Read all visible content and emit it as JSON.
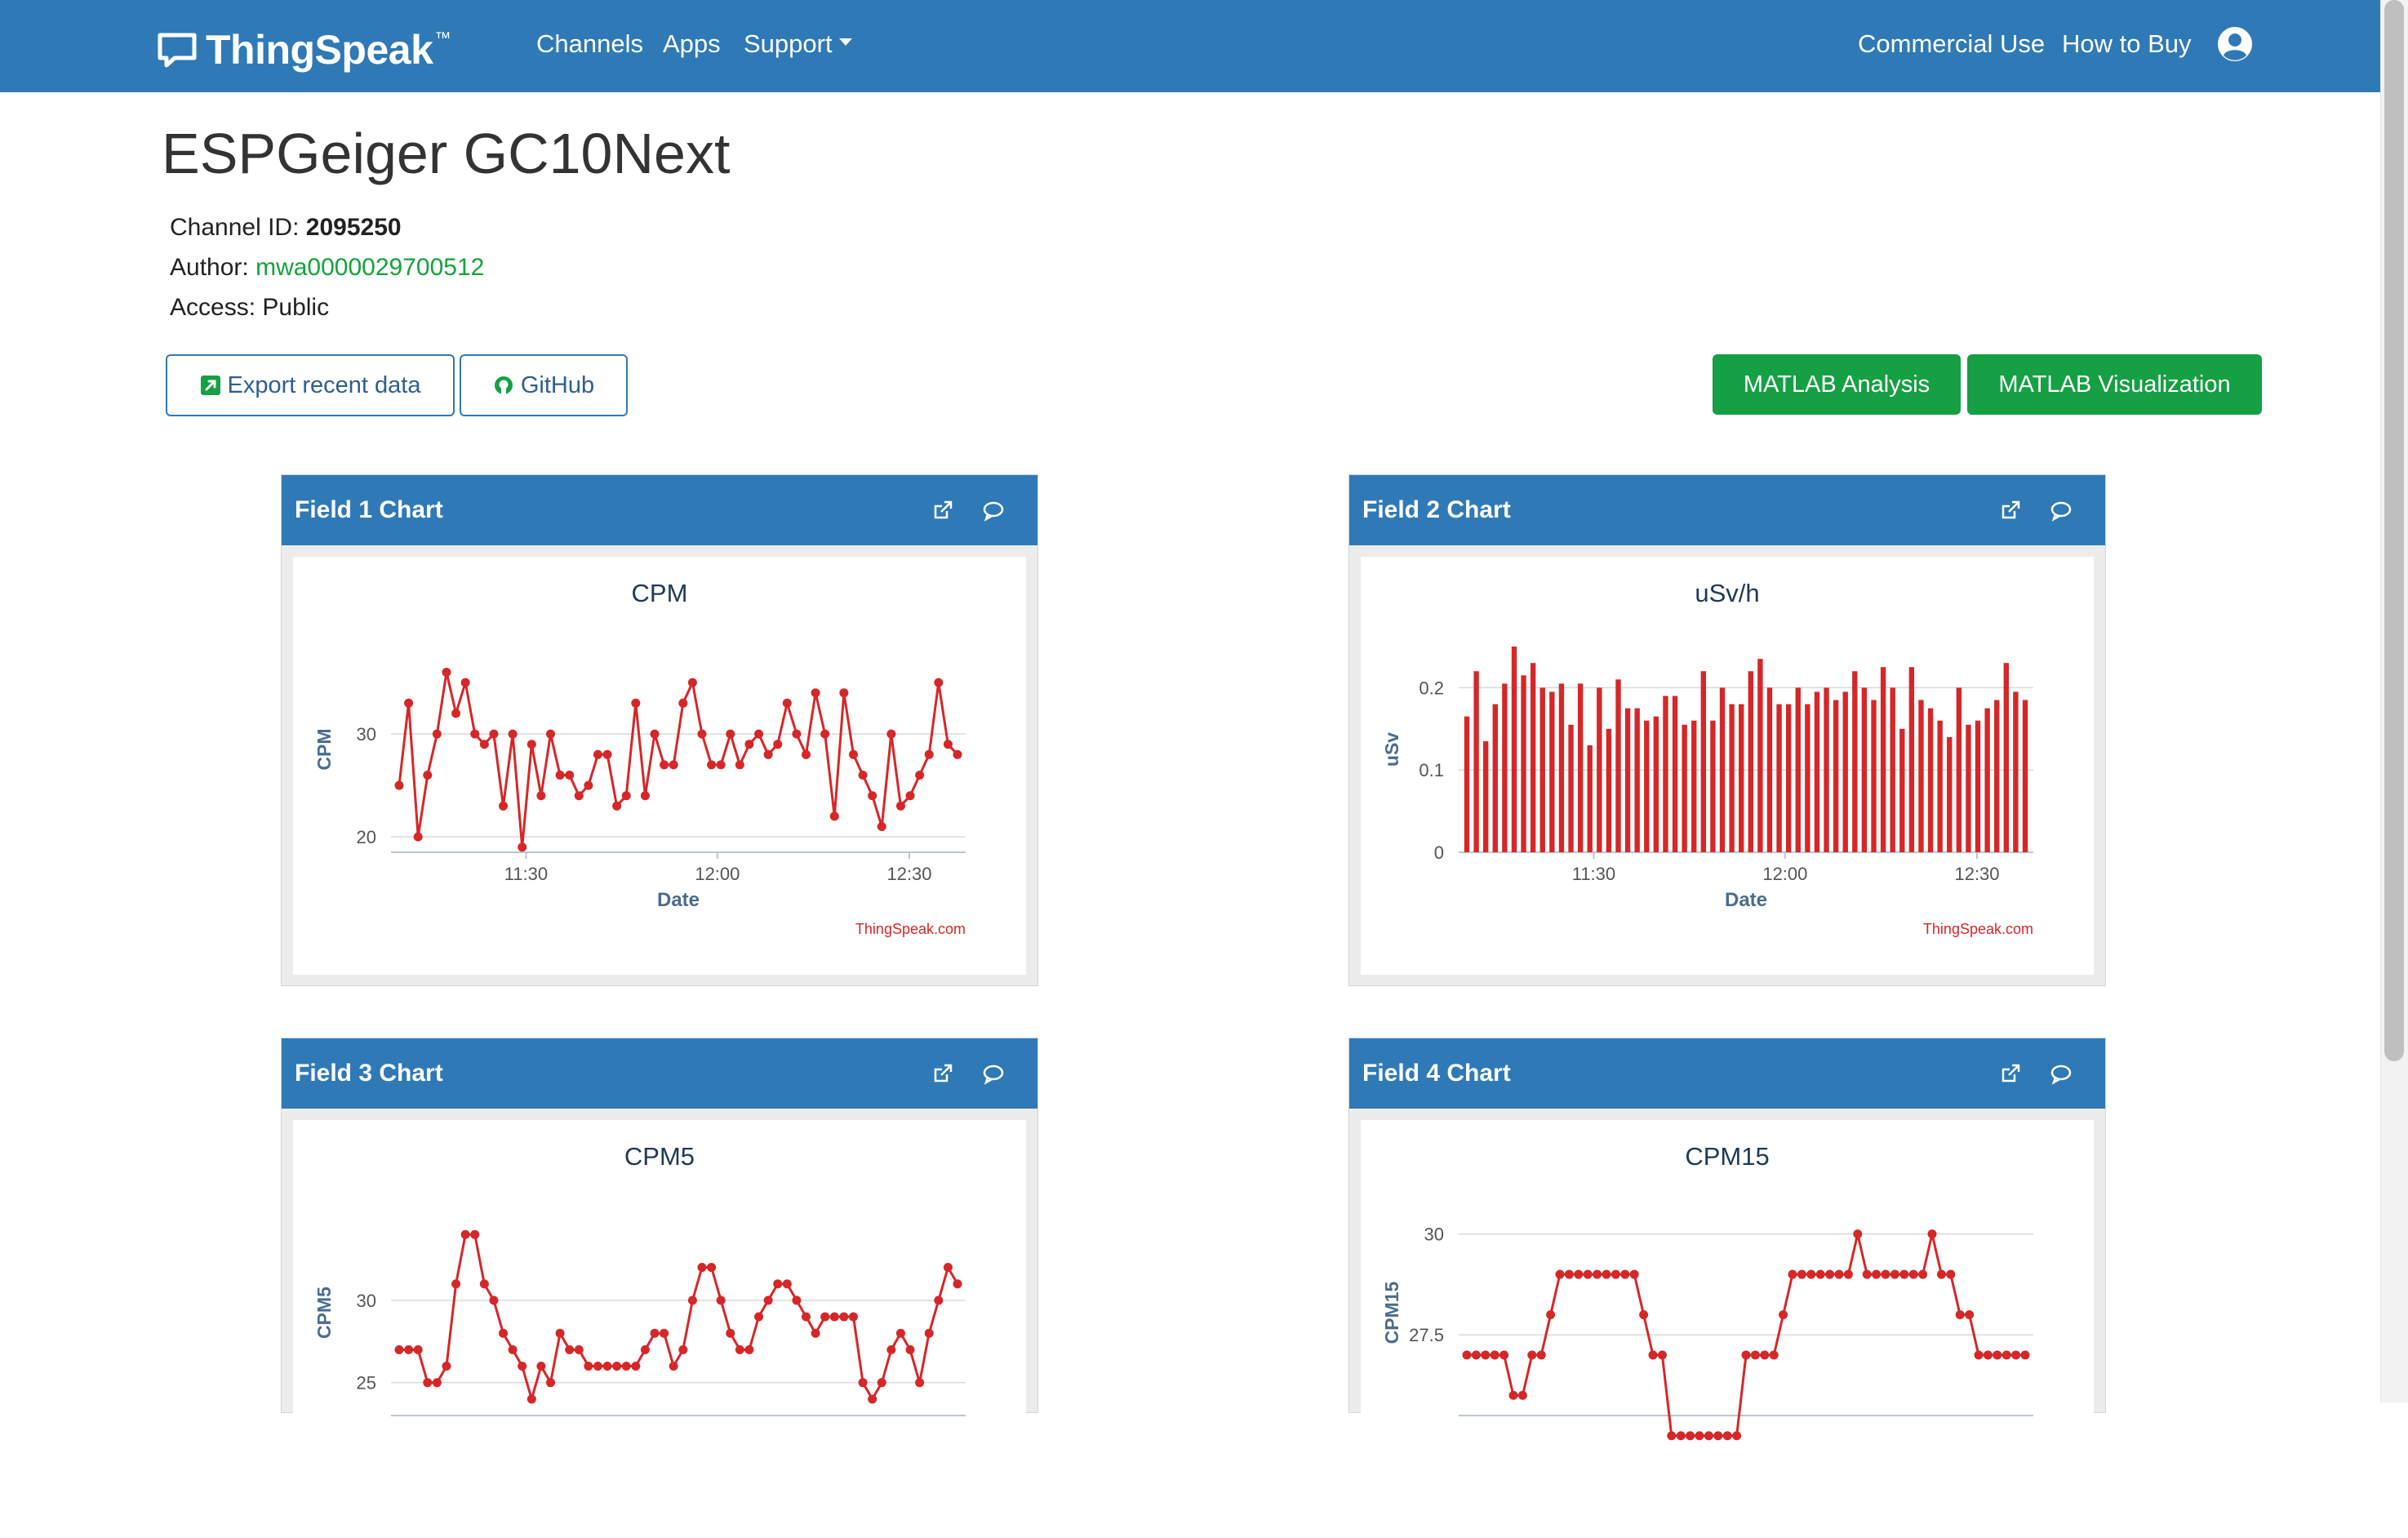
{
  "navbar": {
    "brand": "ThingSpeak",
    "brand_tm": "™",
    "links": [
      "Channels",
      "Apps",
      "Support"
    ],
    "right_links": [
      "Commercial Use",
      "How to Buy"
    ],
    "user_icon": "user-circle-icon"
  },
  "channel": {
    "title": "ESPGeiger GC10Next",
    "id_label": "Channel ID:",
    "id": "2095250",
    "author_label": "Author:",
    "author": "mwa0000029700512",
    "access_label": "Access:",
    "access": "Public"
  },
  "buttons": {
    "export": "Export recent data",
    "github": "GitHub",
    "matlab_analysis": "MATLAB Analysis",
    "matlab_visualization": "MATLAB Visualization"
  },
  "colors": {
    "brand_blue": "#2f7ab6",
    "green": "#15a043",
    "series_red": "#d62728",
    "axis_title_blue": "#4a6d8c"
  },
  "panels": [
    {
      "title": "Field 1 Chart"
    },
    {
      "title": "Field 2 Chart"
    },
    {
      "title": "Field 3 Chart"
    },
    {
      "title": "Field 4 Chart"
    }
  ],
  "credit": "ThingSpeak.com",
  "chart_data": [
    {
      "type": "line",
      "title": "CPM",
      "xlabel": "Date",
      "ylabel": "CPM",
      "x_ticks": [
        "11:30",
        "12:00",
        "12:30"
      ],
      "y_ticks": [
        20,
        30
      ],
      "ylim": [
        18.5,
        38.5
      ],
      "values": [
        25,
        33,
        20,
        26,
        30,
        36,
        32,
        35,
        30,
        29,
        30,
        23,
        30,
        19,
        29,
        24,
        30,
        26,
        26,
        24,
        25,
        28,
        28,
        23,
        24,
        33,
        24,
        30,
        27,
        27,
        33,
        35,
        30,
        27,
        27,
        30,
        27,
        29,
        30,
        28,
        29,
        33,
        30,
        28,
        34,
        30,
        22,
        34,
        28,
        26,
        24,
        21,
        30,
        23,
        24,
        26,
        28,
        35,
        29,
        28
      ],
      "grid": true,
      "legend": "none"
    },
    {
      "type": "bar",
      "title": "uSv/h",
      "xlabel": "Date",
      "ylabel": "uSv",
      "x_ticks": [
        "11:30",
        "12:00",
        "12:30"
      ],
      "y_ticks": [
        0,
        0.1,
        0.2
      ],
      "ylim": [
        0,
        0.25
      ],
      "values": [
        0.165,
        0.22,
        0.135,
        0.18,
        0.205,
        0.25,
        0.215,
        0.23,
        0.2,
        0.195,
        0.205,
        0.155,
        0.205,
        0.13,
        0.2,
        0.15,
        0.21,
        0.175,
        0.175,
        0.16,
        0.165,
        0.19,
        0.19,
        0.155,
        0.16,
        0.22,
        0.16,
        0.2,
        0.18,
        0.18,
        0.22,
        0.235,
        0.2,
        0.18,
        0.18,
        0.2,
        0.18,
        0.195,
        0.2,
        0.185,
        0.195,
        0.22,
        0.2,
        0.185,
        0.225,
        0.2,
        0.15,
        0.225,
        0.185,
        0.175,
        0.16,
        0.14,
        0.2,
        0.155,
        0.16,
        0.175,
        0.185,
        0.23,
        0.195,
        0.185
      ],
      "grid": true,
      "legend": "none"
    },
    {
      "type": "line",
      "title": "CPM5",
      "xlabel": "",
      "ylabel": "CPM5",
      "y_ticks": [
        25,
        30
      ],
      "ylim": [
        23,
        35.5
      ],
      "values": [
        27,
        27,
        27,
        25,
        25,
        26,
        31,
        34,
        34,
        31,
        30,
        28,
        27,
        26,
        24,
        26,
        25,
        28,
        27,
        27,
        26,
        26,
        26,
        26,
        26,
        26,
        27,
        28,
        28,
        26,
        27,
        30,
        32,
        32,
        30,
        28,
        27,
        27,
        29,
        30,
        31,
        31,
        30,
        29,
        28,
        29,
        29,
        29,
        29,
        25,
        24,
        25,
        27,
        28,
        27,
        25,
        28,
        30,
        32,
        31
      ],
      "grid": true,
      "legend": "none"
    },
    {
      "type": "line",
      "title": "CPM15",
      "xlabel": "",
      "ylabel": "CPM15",
      "y_ticks": [
        27.5,
        30
      ],
      "ylim": [
        25.5,
        30.6
      ],
      "values": [
        27,
        27,
        27,
        27,
        27,
        26,
        26,
        27,
        27,
        28,
        29,
        29,
        29,
        29,
        29,
        29,
        29,
        29,
        29,
        28,
        27,
        27,
        25,
        25,
        25,
        25,
        25,
        25,
        25,
        25,
        27,
        27,
        27,
        27,
        28,
        29,
        29,
        29,
        29,
        29,
        29,
        29,
        30,
        29,
        29,
        29,
        29,
        29,
        29,
        29,
        30,
        29,
        29,
        28,
        28,
        27,
        27,
        27,
        27,
        27,
        27
      ],
      "grid": true,
      "legend": "none"
    }
  ]
}
